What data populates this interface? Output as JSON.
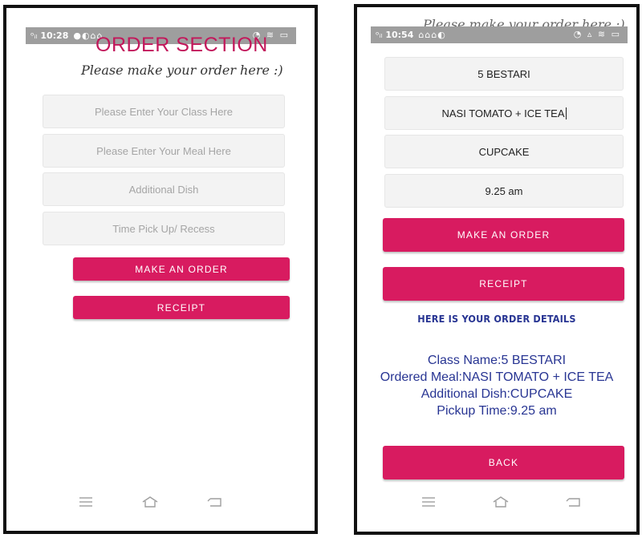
{
  "left_phone": {
    "statusbar": {
      "time": "10:28",
      "icons": "●◐⌂⌂",
      "signal": "ᵒᵢₗ",
      "right_icons": "◔ ≋ ▭"
    },
    "title": "ORDER SECTION",
    "subtitle": "Please make your order here :)",
    "fields": {
      "class_placeholder": "Please Enter Your Class Here",
      "meal_placeholder": "Please Enter Your Meal Here",
      "dish_placeholder": "Additional Dish",
      "time_placeholder": "Time Pick Up/ Recess"
    },
    "buttons": {
      "make_order": "MAKE AN ORDER",
      "receipt": "RECEIPT"
    }
  },
  "right_phone": {
    "statusbar": {
      "time": "10:54",
      "icons": "⌂⌂⌂◐",
      "signal": "ᵒᵢₗ",
      "right_icons": "◔ ▵ ≋ ▭"
    },
    "subtitle_partial": "Please make your order here :)",
    "fields": {
      "class_value": "5 BESTARI",
      "meal_value": "NASI TOMATO + ICE TEA",
      "dish_value": "CUPCAKE",
      "time_value": "9.25 am"
    },
    "buttons": {
      "make_order": "MAKE AN ORDER",
      "receipt": "RECEIPT",
      "back": "BACK"
    },
    "order_heading": "HERE IS YOUR ORDER DETAILS",
    "order_details": {
      "class_line": "Class Name:5 BESTARI",
      "meal_line": "Ordered Meal:NASI TOMATO + ICE TEA",
      "dish_line": "Additional Dish:CUPCAKE",
      "time_line": "Pickup Time:9.25 am"
    }
  },
  "colors": {
    "accent": "#d81b60",
    "title": "#c2185b",
    "detail_text": "#283593",
    "field_bg": "#f3f3f3",
    "statusbar": "#9e9e9e"
  },
  "icons": {
    "nav_menu": "menu-icon",
    "nav_home": "home-icon",
    "nav_back": "back-icon"
  }
}
